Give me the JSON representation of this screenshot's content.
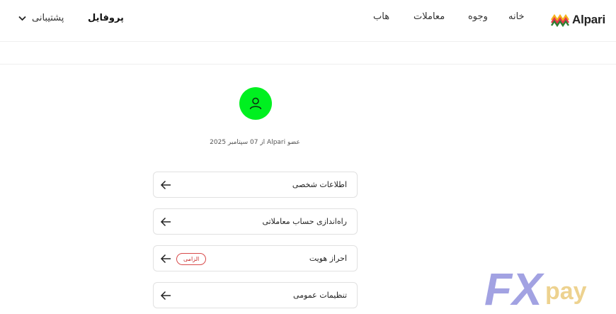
{
  "header": {
    "logo_text": "Alpari",
    "nav": [
      {
        "label": "خانه"
      },
      {
        "label": "وجوه"
      },
      {
        "label": "معاملات"
      },
      {
        "label": "هاب"
      }
    ],
    "profile_label": "پروفایل",
    "support_label": "پشتیبانی"
  },
  "profile": {
    "member_since": "عضو Alpari از 07 سپتامبر 2025",
    "avatar_color": "#00f020"
  },
  "menu": [
    {
      "label": "اطلاعات شخصی"
    },
    {
      "label": "راه‌اندازی حساب معاملاتی"
    },
    {
      "label": "احراز هویت",
      "badge": "الزامی"
    },
    {
      "label": "تنظیمات عمومی"
    }
  ],
  "watermark": {
    "text_fx": "FX",
    "text_pay": "pay"
  },
  "colors": {
    "accent": "#00f020",
    "badge_red": "#d84a4a",
    "fx_purple": "#7b7bd6",
    "pay_gold": "#e8c46a"
  }
}
